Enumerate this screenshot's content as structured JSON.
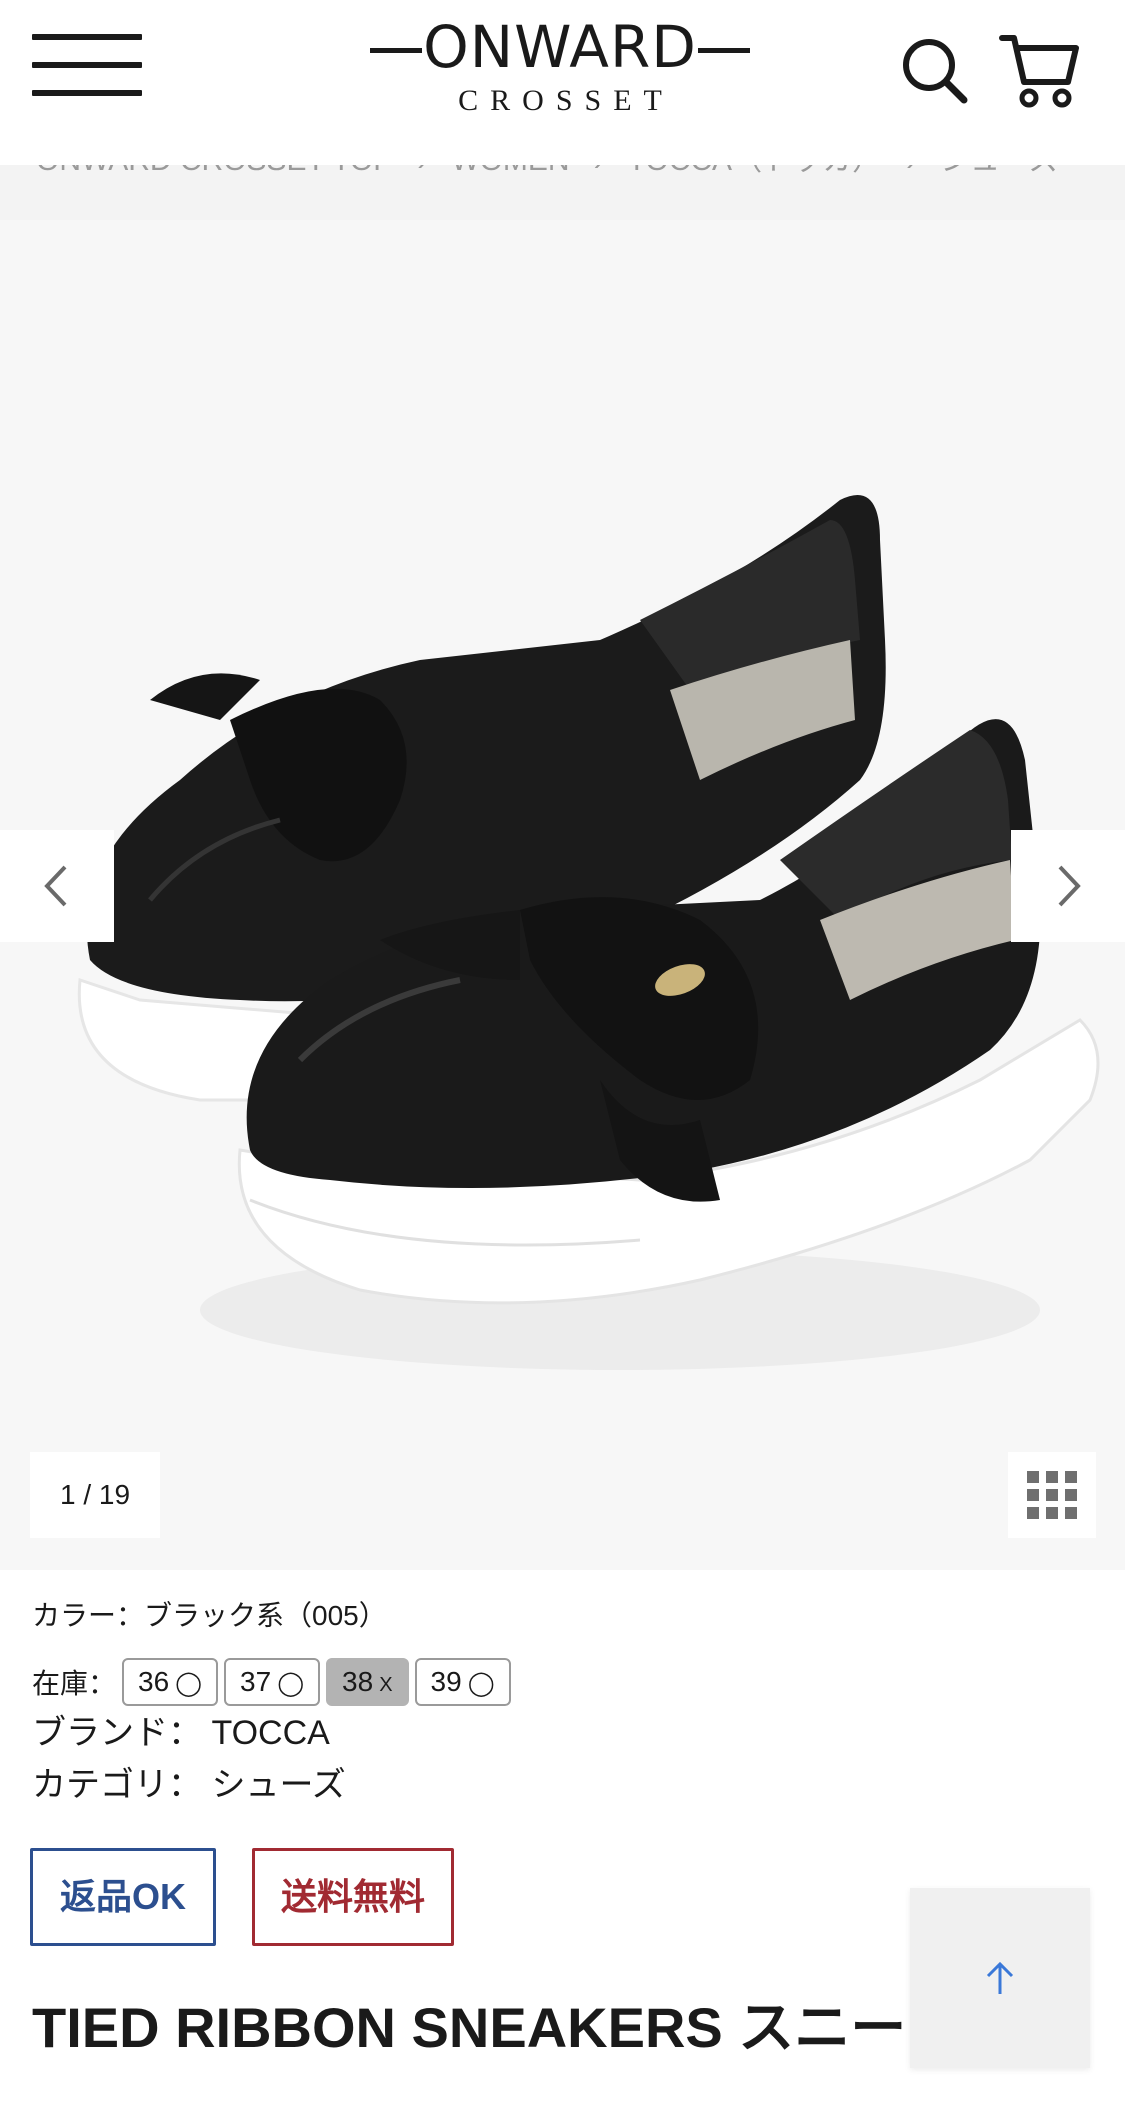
{
  "header": {
    "logo_word": "ONWARD",
    "logo_sub": "CROSSET"
  },
  "breadcrumb": [
    "ONWARD CROSSET TOP",
    "WOMEN",
    "TOCCA（トッカ）",
    "シューズ"
  ],
  "gallery": {
    "counter": "1 / 19"
  },
  "product": {
    "color_label": "カラー：",
    "color_value": "ブラック系（005）",
    "stock_label": "在庫：",
    "sizes": [
      {
        "size": "36",
        "mark": "◯",
        "available": true
      },
      {
        "size": "37",
        "mark": "◯",
        "available": true
      },
      {
        "size": "38",
        "mark": "X",
        "available": false
      },
      {
        "size": "39",
        "mark": "◯",
        "available": true
      }
    ],
    "brand_label": "ブランド：",
    "brand_value": "TOCCA",
    "category_label": "カテゴリ：",
    "category_value": "シューズ",
    "badges": {
      "return": "返品OK",
      "shipping": "送料無料"
    },
    "title": "TIED RIBBON SNEAKERS スニーカー"
  },
  "colors": {
    "return_badge": "#2c4f8f",
    "shipping_badge": "#a12a32",
    "scroll_top_arrow": "#3a78d8"
  },
  "icons": {
    "menu": "hamburger-icon",
    "search": "search-icon",
    "cart": "cart-icon",
    "prev": "chevron-left-icon",
    "next": "chevron-right-icon",
    "grid": "grid-icon",
    "scroll_top": "arrow-up-icon"
  }
}
